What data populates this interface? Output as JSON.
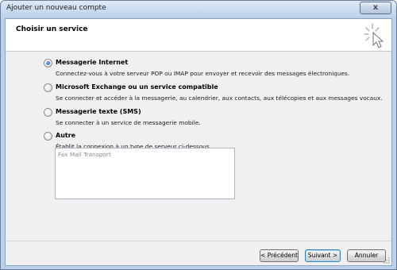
{
  "window": {
    "title": "Ajouter un nouveau compte",
    "close_glyph": "x"
  },
  "header": {
    "title": "Choisir un service",
    "icon": "wizard-sparkle-icon"
  },
  "options": [
    {
      "label": "Messagerie Internet",
      "description": "Connectez-vous à votre serveur POP ou IMAP pour envoyer et recevoir des messages électroniques.",
      "selected": true
    },
    {
      "label": "Microsoft Exchange ou un service compatible",
      "description": "Se connecter et accéder à la messagerie, au calendrier, aux contacts, aux télécopies et aux messages vocaux.",
      "selected": false
    },
    {
      "label": "Messagerie texte (SMS)",
      "description": "Se connecter à un service de messagerie mobile.",
      "selected": false
    },
    {
      "label": "Autre",
      "description": "Établit la connexion à un type de serveur ci-dessous.",
      "selected": false
    }
  ],
  "server_list": {
    "items": [
      "Fax Mail Transport"
    ]
  },
  "buttons": {
    "previous": "< Précédent",
    "next": "Suivant >",
    "cancel": "Annuler"
  },
  "colors": {
    "accent": "#3c7fb1",
    "window_frame": "#b9d1ea"
  }
}
